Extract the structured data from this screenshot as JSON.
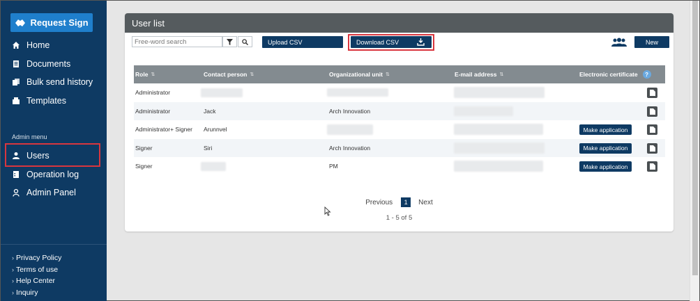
{
  "brand": {
    "label": "Request Sign"
  },
  "nav": [
    {
      "label": "Home",
      "icon": "home-icon"
    },
    {
      "label": "Documents",
      "icon": "documents-icon"
    },
    {
      "label": "Bulk send history",
      "icon": "bulk-send-icon"
    },
    {
      "label": "Templates",
      "icon": "templates-icon"
    }
  ],
  "admin": {
    "label": "Admin menu",
    "items": [
      {
        "label": "Users",
        "icon": "user-icon"
      },
      {
        "label": "Operation log",
        "icon": "log-icon"
      },
      {
        "label": "Admin Panel",
        "icon": "admin-panel-icon"
      }
    ]
  },
  "footer": [
    {
      "label": "Privacy Policy"
    },
    {
      "label": "Terms of use"
    },
    {
      "label": "Help Center"
    },
    {
      "label": "Inquiry"
    }
  ],
  "panel": {
    "title": "User list",
    "search_placeholder": "Free-word search",
    "upload_label": "Upload CSV",
    "download_label": "Download CSV",
    "new_label": "New"
  },
  "table": {
    "headers": {
      "role": "Role",
      "contact": "Contact person",
      "org": "Organizational unit",
      "email": "E-mail address",
      "cert": "Electronic certificate",
      "help": "?"
    },
    "rows": [
      {
        "role": "Administrator",
        "contact": "",
        "org": "",
        "email": "",
        "make": false
      },
      {
        "role": "Administrator",
        "contact": "Jack",
        "org": "Arch Innovation",
        "email": "",
        "make": false
      },
      {
        "role": "Administrator+ Signer",
        "contact": "Arunnvel",
        "org": "",
        "email": "",
        "make": true
      },
      {
        "role": "Signer",
        "contact": "Siri",
        "org": "Arch Innovation",
        "email": "",
        "make": true
      },
      {
        "role": "Signer",
        "contact": "",
        "org": "PM",
        "email": "",
        "make": true
      }
    ],
    "make_label": "Make application"
  },
  "pagination": {
    "previous": "Previous",
    "current": "1",
    "next": "Next",
    "range": "1 - 5 of 5"
  },
  "colors": {
    "sidebar": "#0e3a63",
    "accent": "#1f7fcc",
    "highlight": "#d9363e",
    "header_bar": "#555b5e"
  }
}
